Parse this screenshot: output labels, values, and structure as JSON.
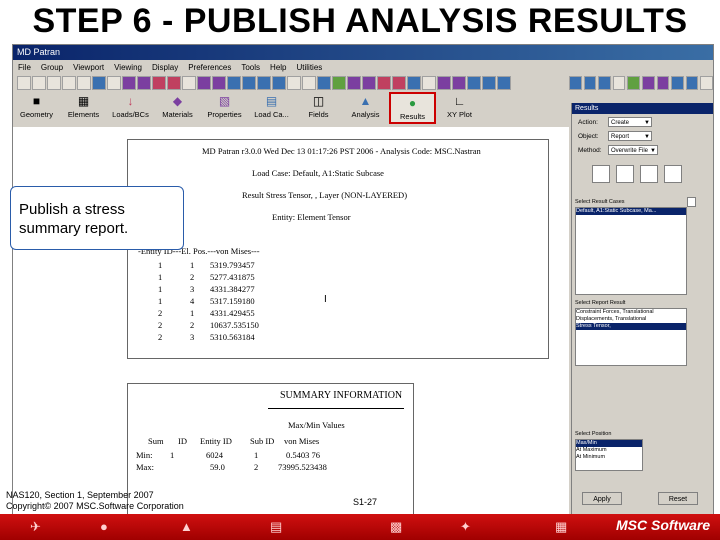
{
  "slide_title": "STEP 6 - PUBLISH ANALYSIS RESULTS",
  "window": {
    "title": "MD Patran"
  },
  "menu": [
    "File",
    "Group",
    "Viewport",
    "Viewing",
    "Display",
    "Preferences",
    "Tools",
    "Help",
    "Utilities"
  ],
  "app_buttons": [
    {
      "label": "Geometry",
      "icon": "cube-icon",
      "active": false
    },
    {
      "label": "Elements",
      "icon": "mesh-icon",
      "active": false
    },
    {
      "label": "Loads/BCs",
      "icon": "load-icon",
      "active": false
    },
    {
      "label": "Materials",
      "icon": "material-icon",
      "active": false
    },
    {
      "label": "Properties",
      "icon": "properties-icon",
      "active": false
    },
    {
      "label": "Load Ca...",
      "icon": "load-case-icon",
      "active": false
    },
    {
      "label": "Fields",
      "icon": "fields-icon",
      "active": false
    },
    {
      "label": "Analysis",
      "icon": "analysis-icon",
      "active": false
    },
    {
      "label": "Results",
      "icon": "results-icon",
      "active": true
    },
    {
      "label": "XY Plot",
      "icon": "xy-plot-icon",
      "active": false
    }
  ],
  "results_panel": {
    "title": "Results",
    "fields": [
      {
        "label": "Action:",
        "value": "Create"
      },
      {
        "label": "Object:",
        "value": "Report"
      },
      {
        "label": "Method:",
        "value": "Overwrite File"
      }
    ],
    "result_cases_label": "Select Result Cases",
    "result_cases": [
      "Default, A1:Static Subcase, Ma...",
      ""
    ],
    "result_types_label": "Select Report Result",
    "result_types": [
      "Constraint Forces, Translational",
      "Displacements, Translational",
      "Stress Tensor,"
    ],
    "position_label": "Select Position",
    "positions": [
      "Max/Min",
      "At Maximum",
      "At Minimum"
    ],
    "apply_label": "Apply",
    "reset_label": "Reset"
  },
  "report1": {
    "header": "MD Patran r3.0.0 Wed Dec 13 01:17:26 PST 2006 - Analysis Code: MSC.Nastran",
    "load_case": "Load Case: Default, A1:Static Subcase",
    "result": "Result Stress Tensor, , Layer (NON-LAYERED)",
    "entity": "Entity: Element Tensor",
    "columns": "-Entity ID---El. Pos.---von Mises---",
    "rows": [
      [
        "1",
        "1",
        "5319.793457"
      ],
      [
        "1",
        "2",
        "5277.431875"
      ],
      [
        "1",
        "3",
        "4331.384277"
      ],
      [
        "1",
        "4",
        "5317.159180"
      ],
      [
        "2",
        "1",
        "4331.429455"
      ],
      [
        "2",
        "2",
        "10637.535150"
      ],
      [
        "2",
        "3",
        "5310.563184"
      ]
    ]
  },
  "report2": {
    "title": "SUMMARY INFORMATION",
    "subtitle": "Max/Min Values",
    "columns": [
      "Sum",
      "ID",
      "Entity ID",
      "Sub ID",
      "von Mises"
    ],
    "rows": [
      [
        "Min:",
        "1",
        "6024",
        "1",
        "0.5403 76"
      ],
      [
        "Max:",
        "",
        "59.0",
        "2",
        "73995.523438"
      ]
    ]
  },
  "callout": "Publish a stress summary report.",
  "footer": {
    "line1": "NAS120, Section 1, September 2007",
    "line2": "Copyright© 2007 MSC.Software Corporation",
    "page": "S1-27"
  },
  "logo": "MSC Software",
  "colors": {
    "title_bar": "#0a246a",
    "highlight_border": "#cc0000",
    "bottom_strip": "#c00000"
  }
}
